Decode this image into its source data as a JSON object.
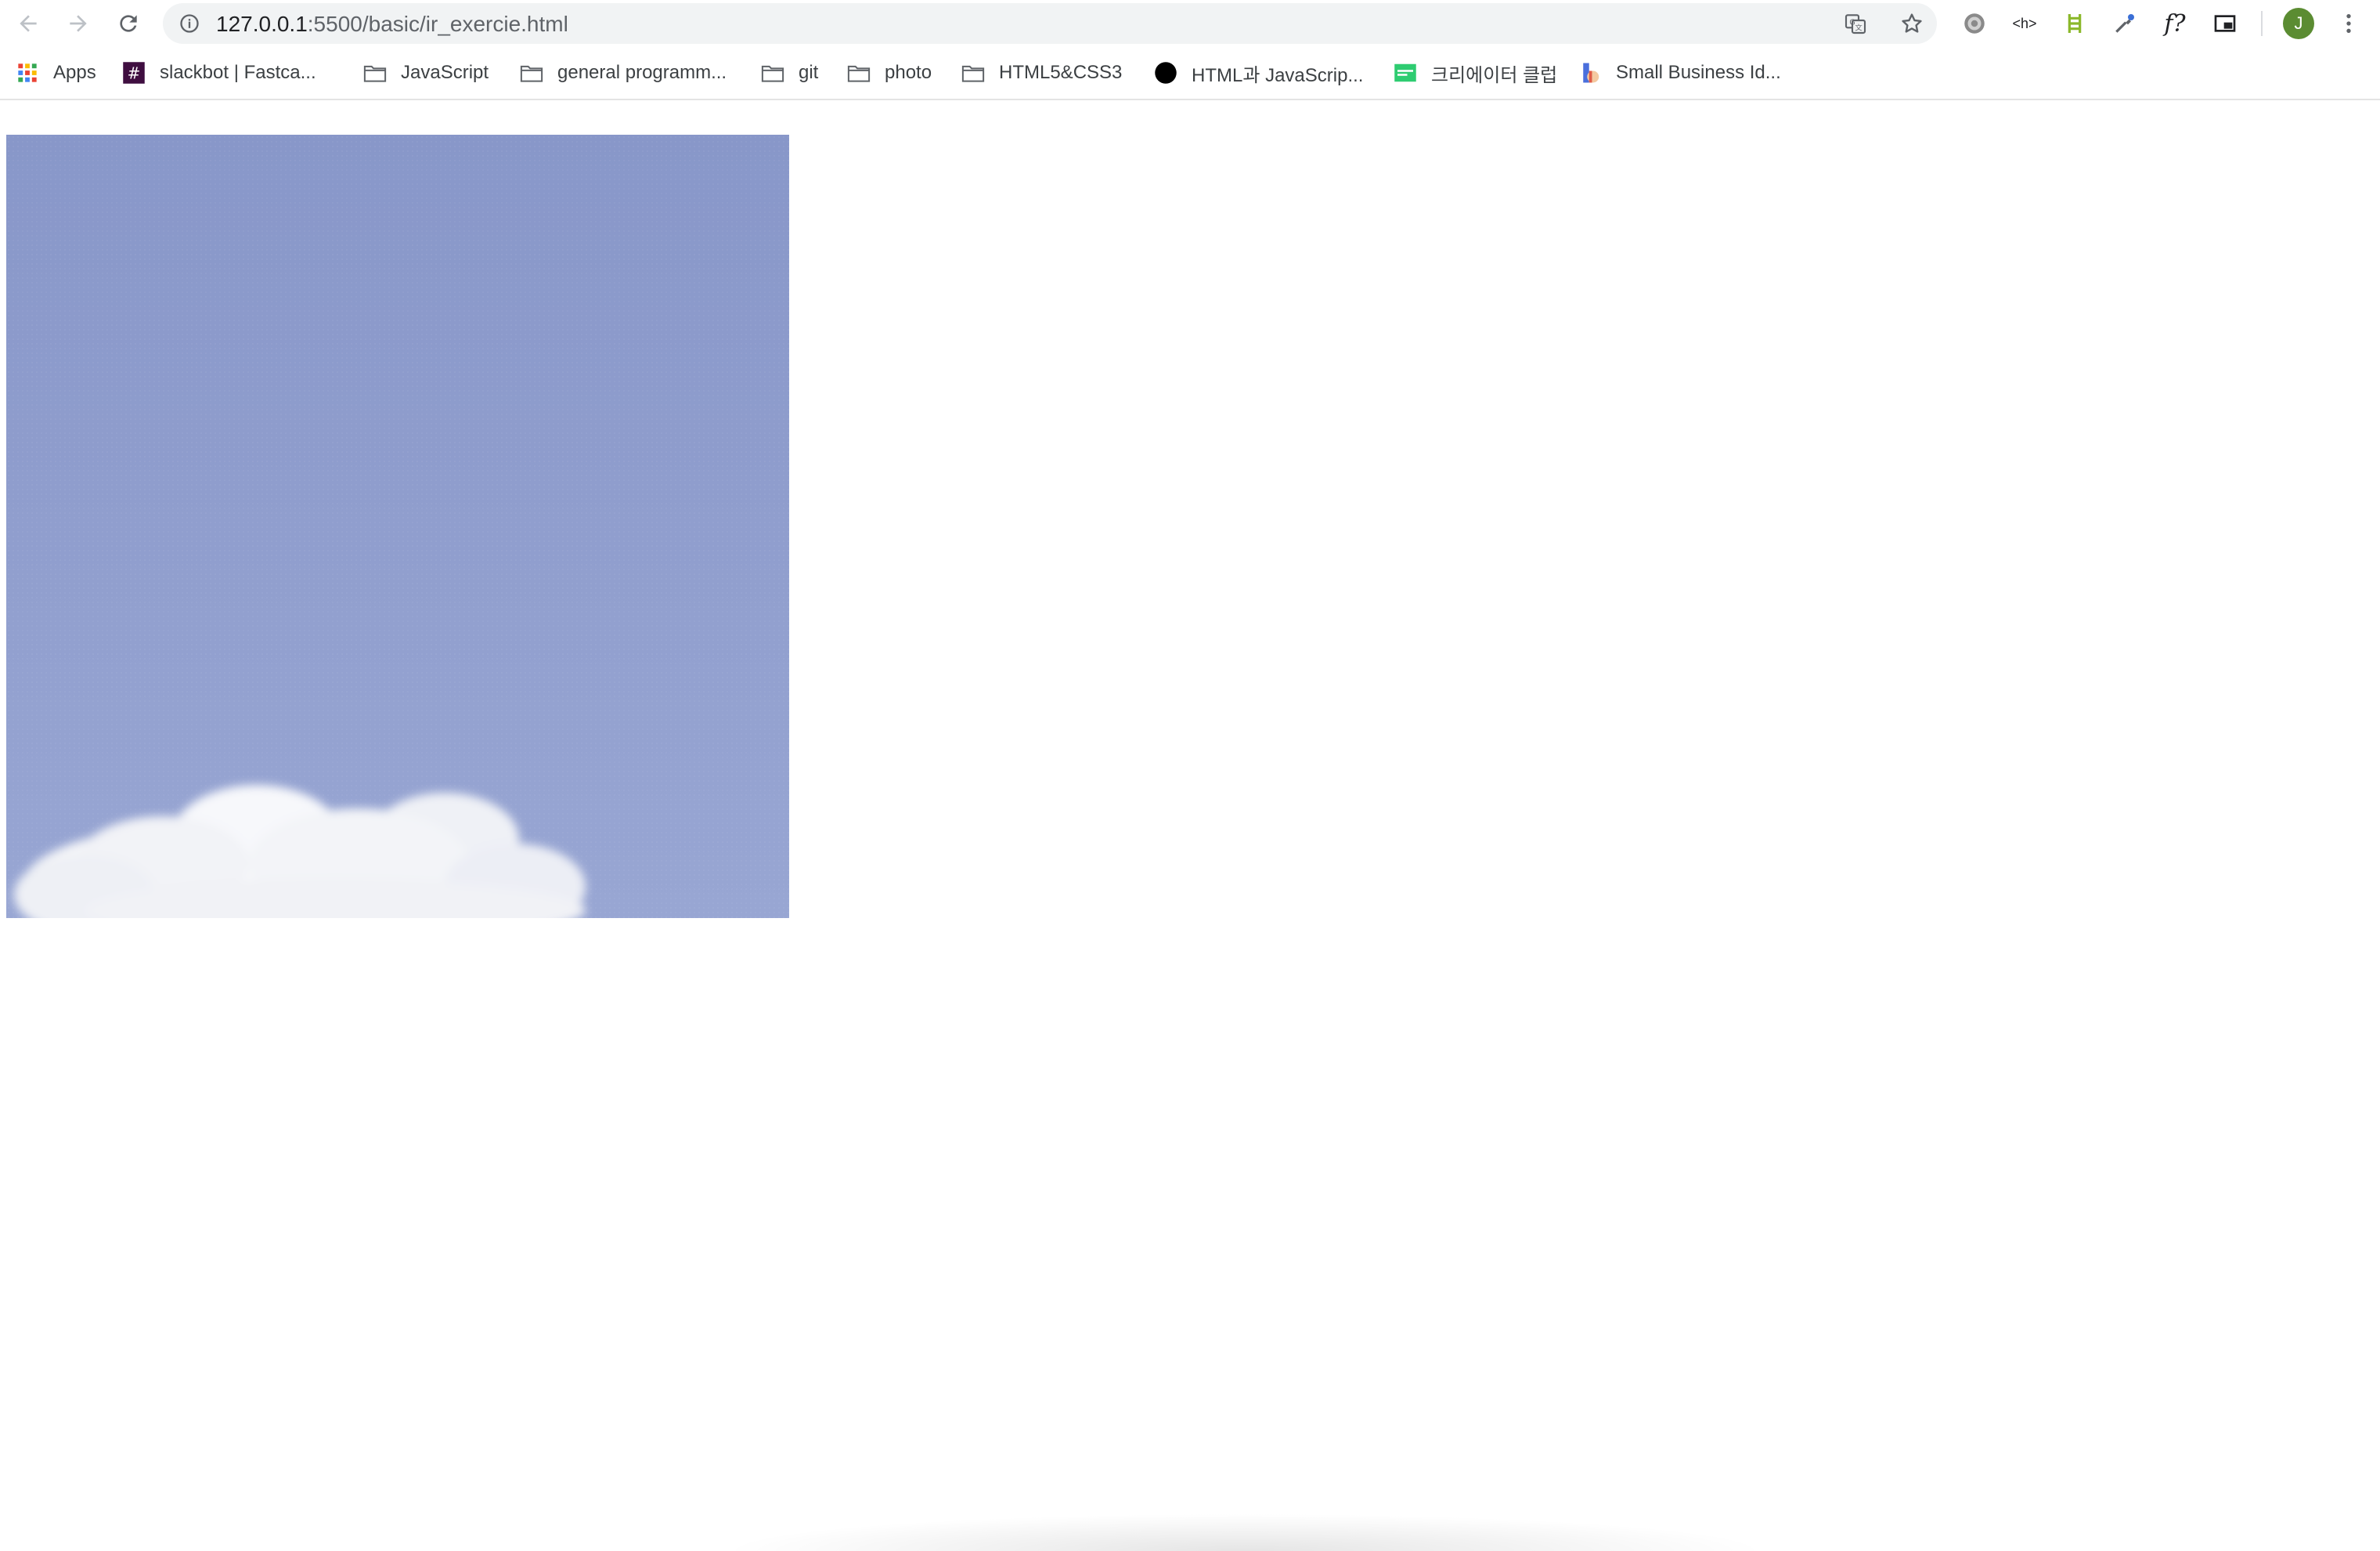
{
  "browser": {
    "url_host": "127.0.0.1",
    "url_path": ":5500/basic/ir_exercie.html",
    "avatar_initial": "J",
    "extensions": [
      "settings-gear-icon",
      "html-headings-icon",
      "ladder-icon",
      "eyedropper-icon",
      "font-detect-icon",
      "cast-icon"
    ]
  },
  "bookmarks": [
    {
      "label": "Apps",
      "icon": "apps-grid-icon"
    },
    {
      "label": "slackbot | Fastca...",
      "icon": "slack-hash-icon"
    },
    {
      "label": "JavaScript",
      "icon": "folder-icon"
    },
    {
      "label": "general programm...",
      "icon": "folder-icon"
    },
    {
      "label": "git",
      "icon": "folder-icon"
    },
    {
      "label": "photo",
      "icon": "folder-icon"
    },
    {
      "label": "HTML5&CSS3",
      "icon": "folder-icon"
    },
    {
      "label": "HTML과 JavaScrip...",
      "icon": "black-circle-icon"
    },
    {
      "label": "크리에이터 클럽",
      "icon": "green-logo-icon"
    },
    {
      "label": "Small Business Id...",
      "icon": "colorful-logo-icon"
    }
  ],
  "page": {
    "image_description_icon": "sky-with-cloud-image"
  }
}
